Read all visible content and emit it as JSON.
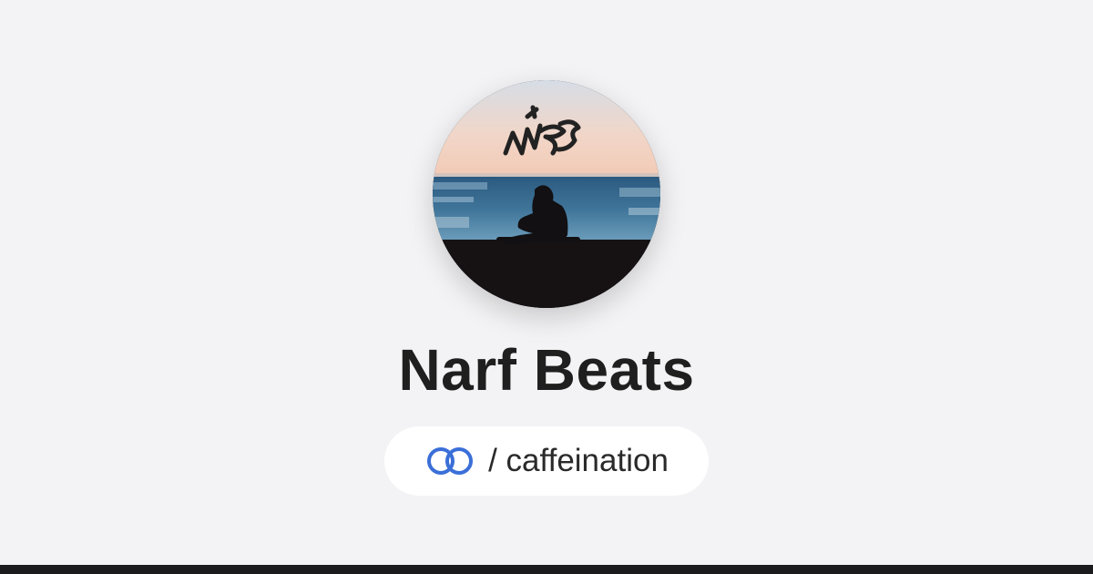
{
  "profile": {
    "name": "Narf Beats",
    "handle_prefix": "/",
    "handle": "caffeination"
  },
  "avatar": {
    "alt": "profile-avatar",
    "signature_text": "NARF"
  },
  "brand": {
    "logo_icon": "linked-rings-icon",
    "logo_color": "#3b6fd8"
  },
  "colors": {
    "background": "#f3f3f5",
    "title": "#1f1f1f",
    "pill_background": "#ffffff",
    "footer_bar": "#1b1b1d"
  }
}
